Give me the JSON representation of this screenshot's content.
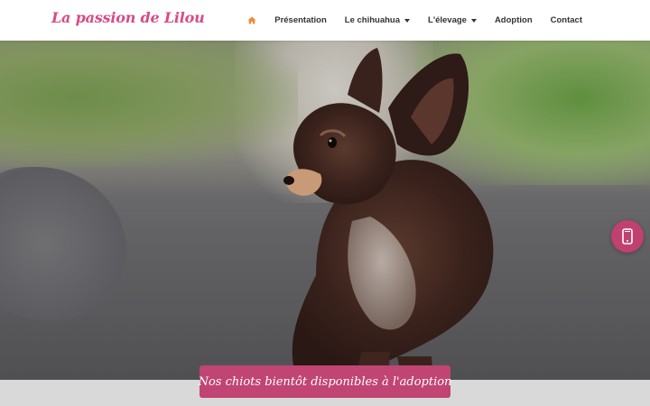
{
  "header": {
    "logo_text": "La passion de Lilou",
    "nav": [
      {
        "label": ""
      },
      {
        "label": "Présentation"
      },
      {
        "label": "Le chihuahua"
      },
      {
        "label": "L'élevage"
      },
      {
        "label": "Adoption"
      },
      {
        "label": "Contact"
      }
    ]
  },
  "icons": {
    "home": "home-icon",
    "phone": "mobile-phone-icon"
  },
  "hero": {
    "cta_label": "Nos chiots bientôt disponibles à l'adoption"
  },
  "colors": {
    "brand": "#d84b86",
    "accent_home": "#f08a3a",
    "cta": "#c04573",
    "phone_button": "#c0416f"
  }
}
